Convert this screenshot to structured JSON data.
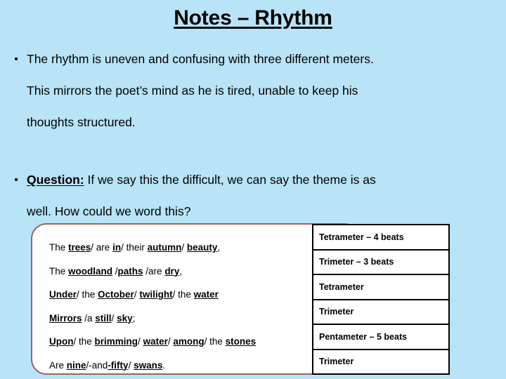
{
  "slide": {
    "background_color": "#b9e4f7",
    "title": "Notes – Rhythm"
  },
  "body": {
    "bullets": [
      {
        "marker": "•",
        "lines": [
          "The rhythm is uneven and confusing with three different meters.",
          "This mirrors the poet’s mind as he is tired, unable to keep his",
          "thoughts structured."
        ]
      },
      {
        "marker": "•",
        "label": "Question:",
        "lines": [
          "If we say this the difficult, we can say the theme is as",
          "well. How could we word this?"
        ]
      }
    ]
  },
  "poem_box": {
    "border_color": "#a75c5c",
    "fill_color": "#ffffff",
    "lines": [
      [
        {
          "t": "The ",
          "stressed": false
        },
        {
          "t": "trees",
          "stressed": true
        },
        {
          "t": "/ are ",
          "stressed": false
        },
        {
          "t": "in",
          "stressed": true
        },
        {
          "t": "/ their ",
          "stressed": false
        },
        {
          "t": "autumn",
          "stressed": true
        },
        {
          "t": "/ ",
          "stressed": false
        },
        {
          "t": "beauty",
          "stressed": true
        },
        {
          "t": ",",
          "stressed": false
        }
      ],
      [
        {
          "t": "The ",
          "stressed": false
        },
        {
          "t": "woodland",
          "stressed": true
        },
        {
          "t": " /",
          "stressed": false
        },
        {
          "t": "paths",
          "stressed": true
        },
        {
          "t": " /are ",
          "stressed": false
        },
        {
          "t": "dry",
          "stressed": true
        },
        {
          "t": ",",
          "stressed": false
        }
      ],
      [
        {
          "t": "Under",
          "stressed": true
        },
        {
          "t": "/ the ",
          "stressed": false
        },
        {
          "t": "October",
          "stressed": true
        },
        {
          "t": "/ ",
          "stressed": false
        },
        {
          "t": "twilight",
          "stressed": true
        },
        {
          "t": "/ the ",
          "stressed": false
        },
        {
          "t": "water",
          "stressed": true
        }
      ],
      [
        {
          "t": "Mirrors",
          "stressed": true
        },
        {
          "t": " /a ",
          "stressed": false
        },
        {
          "t": "still",
          "stressed": true
        },
        {
          "t": "/ ",
          "stressed": false
        },
        {
          "t": "sky",
          "stressed": true
        },
        {
          "t": ";",
          "stressed": false
        }
      ],
      [
        {
          "t": "Upon",
          "stressed": true
        },
        {
          "t": "/ the ",
          "stressed": false
        },
        {
          "t": "brimming",
          "stressed": true
        },
        {
          "t": "/ ",
          "stressed": false
        },
        {
          "t": "water",
          "stressed": true
        },
        {
          "t": "/ ",
          "stressed": false
        },
        {
          "t": "among",
          "stressed": true
        },
        {
          "t": "/ the ",
          "stressed": false
        },
        {
          "t": "stones",
          "stressed": true
        }
      ],
      [
        {
          "t": "Are ",
          "stressed": false
        },
        {
          "t": "nine",
          "stressed": true
        },
        {
          "t": "/-and",
          "stressed": false
        },
        {
          "t": "-fifty",
          "stressed": true
        },
        {
          "t": "/ ",
          "stressed": false
        },
        {
          "t": "swans",
          "stressed": true
        },
        {
          "t": ".",
          "stressed": false
        }
      ]
    ]
  },
  "meter_table": {
    "rows": [
      "Tetrameter – 4 beats",
      "Trimeter – 3 beats",
      "Tetrameter",
      "Trimeter",
      "Pentameter – 5 beats",
      "Trimeter"
    ]
  }
}
